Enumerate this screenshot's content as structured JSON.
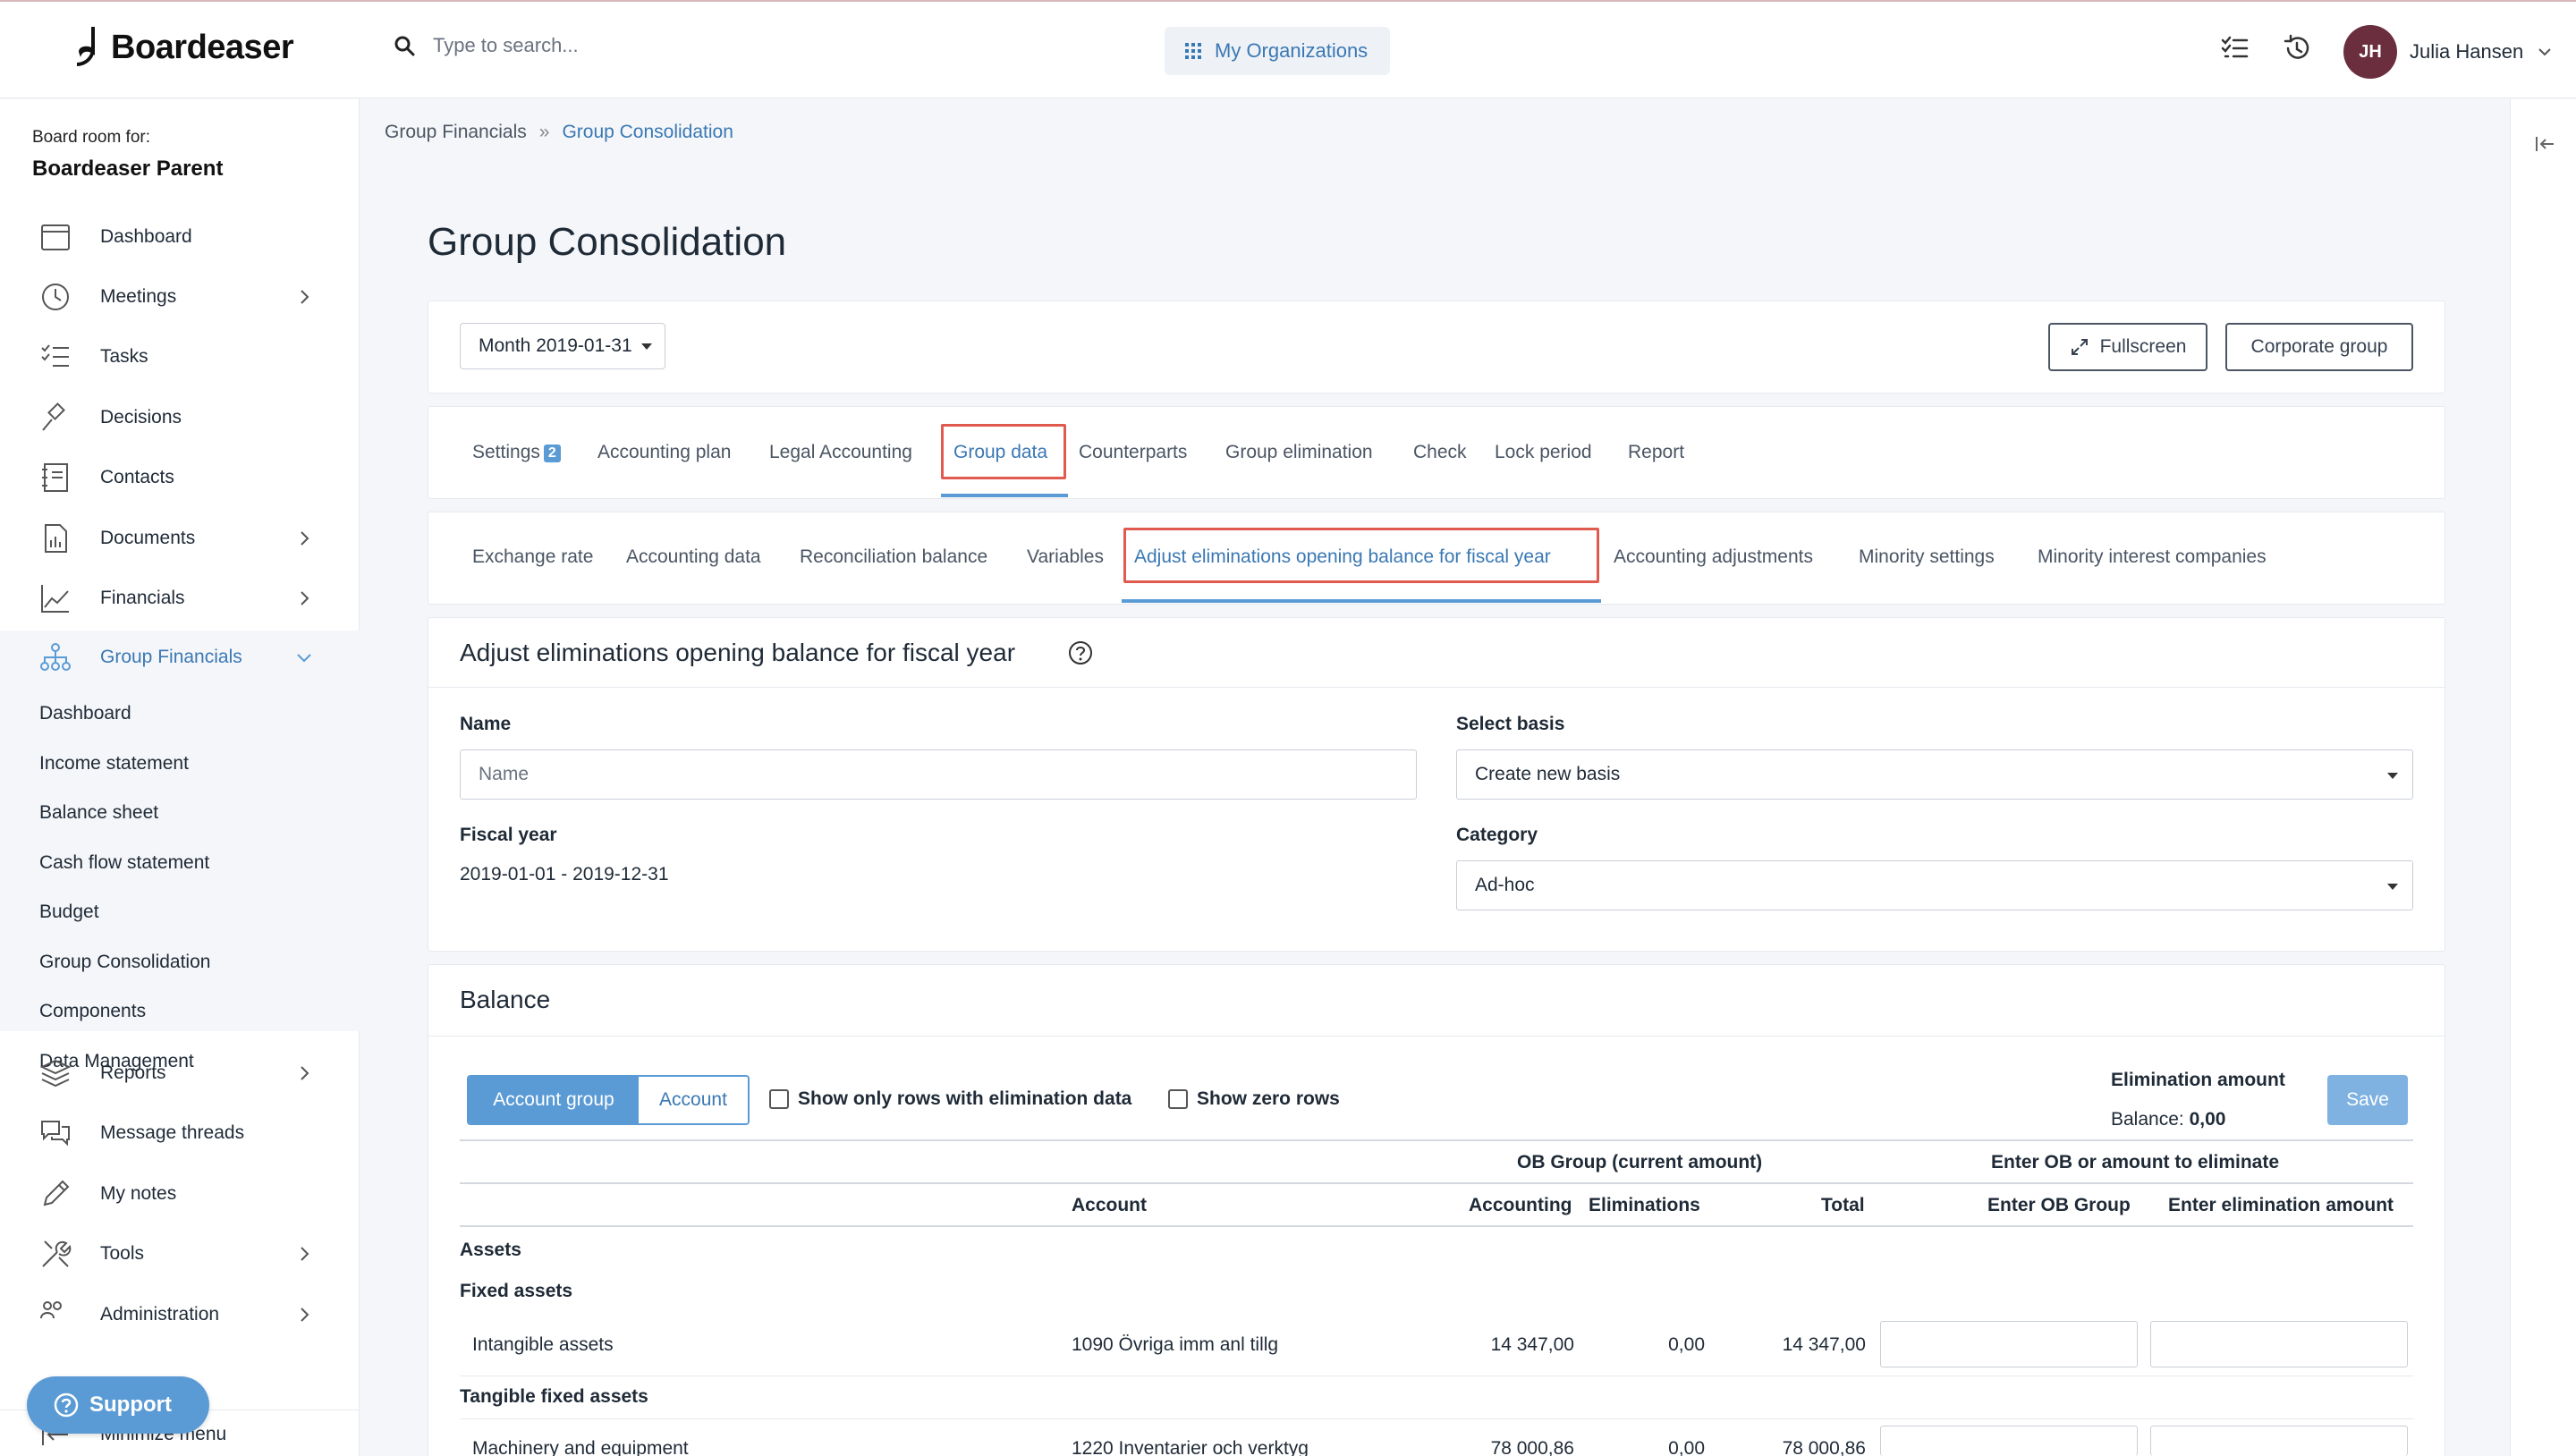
{
  "app": {
    "logo_text": "Boardeaser"
  },
  "topbar": {
    "search_placeholder": "Type to search...",
    "my_orgs_label": "My Organizations",
    "user_initials": "JH",
    "user_name": "Julia Hansen"
  },
  "sidebar": {
    "board_label": "Board room for:",
    "board_name": "Boardeaser Parent",
    "items": [
      {
        "label": "Dashboard"
      },
      {
        "label": "Meetings"
      },
      {
        "label": "Tasks"
      },
      {
        "label": "Decisions"
      },
      {
        "label": "Contacts"
      },
      {
        "label": "Documents"
      },
      {
        "label": "Financials"
      },
      {
        "label": "Group Financials"
      },
      {
        "label": "Reports"
      },
      {
        "label": "Message threads"
      },
      {
        "label": "My notes"
      },
      {
        "label": "Tools"
      },
      {
        "label": "Administration"
      },
      {
        "label": "Minimize menu"
      }
    ],
    "sub_items": [
      {
        "label": "Dashboard"
      },
      {
        "label": "Income statement"
      },
      {
        "label": "Balance sheet"
      },
      {
        "label": "Cash flow statement"
      },
      {
        "label": "Budget"
      },
      {
        "label": "Group Consolidation"
      },
      {
        "label": "Components"
      },
      {
        "label": "Data Management"
      }
    ],
    "support_label": "Support"
  },
  "breadcrumb": {
    "parent": "Group Financials",
    "separator": "»",
    "current": "Group Consolidation"
  },
  "page_title": "Group Consolidation",
  "toolbar": {
    "period": "Month 2019-01-31",
    "fullscreen_label": "Fullscreen",
    "corporate_group_label": "Corporate group"
  },
  "tabs": {
    "settings": "Settings",
    "settings_badge": "2",
    "accounting_plan": "Accounting plan",
    "legal_accounting": "Legal Accounting",
    "group_data": "Group data",
    "counterparts": "Counterparts",
    "group_elimination": "Group elimination",
    "check": "Check",
    "lock_period": "Lock period",
    "report": "Report"
  },
  "subtabs": {
    "exchange_rate": "Exchange rate",
    "accounting_data": "Accounting data",
    "reconciliation_balance": "Reconciliation balance",
    "variables": "Variables",
    "adjust_eliminations": "Adjust eliminations opening balance for fiscal year",
    "accounting_adjustments": "Accounting adjustments",
    "minority_settings": "Minority settings",
    "minority_interest_companies": "Minority interest companies"
  },
  "form": {
    "title": "Adjust eliminations opening balance for fiscal year",
    "name_label": "Name",
    "name_placeholder": "Name",
    "basis_label": "Select basis",
    "basis_value": "Create new basis",
    "fiscal_year_label": "Fiscal year",
    "fiscal_year_value": "2019-01-01 - 2019-12-31",
    "category_label": "Category",
    "category_value": "Ad-hoc"
  },
  "balance": {
    "title": "Balance",
    "toggle_group": "Account group",
    "toggle_account": "Account",
    "check_elim_rows": "Show only rows with elimination data",
    "check_zero_rows": "Show zero rows",
    "elim_amount_label": "Elimination amount",
    "balance_label": "Balance:",
    "balance_value": "0,00",
    "save_label": "Save",
    "header_ob_group": "OB Group (current amount)",
    "header_enter_ob": "Enter OB or amount to eliminate",
    "col_account": "Account",
    "col_accounting": "Accounting",
    "col_eliminations": "Eliminations",
    "col_total": "Total",
    "col_enter_ob_group": "Enter OB Group",
    "col_enter_elim": "Enter elimination amount",
    "section_assets": "Assets",
    "section_fixed_assets": "Fixed assets",
    "section_tangible": "Tangible fixed assets",
    "rows": [
      {
        "name": "Intangible assets",
        "account": "1090 Övriga imm anl tillg",
        "accounting": "14 347,00",
        "eliminations": "0,00",
        "total": "14 347,00"
      },
      {
        "name": "Machinery and equipment",
        "account": "1220 Inventarier och verktyg",
        "accounting": "78 000,86",
        "eliminations": "0,00",
        "total": "78 000,86"
      }
    ]
  },
  "colors": {
    "accent": "#3a78b4",
    "accent_light": "#5b9bd5",
    "highlight_box": "#e05a4f"
  }
}
